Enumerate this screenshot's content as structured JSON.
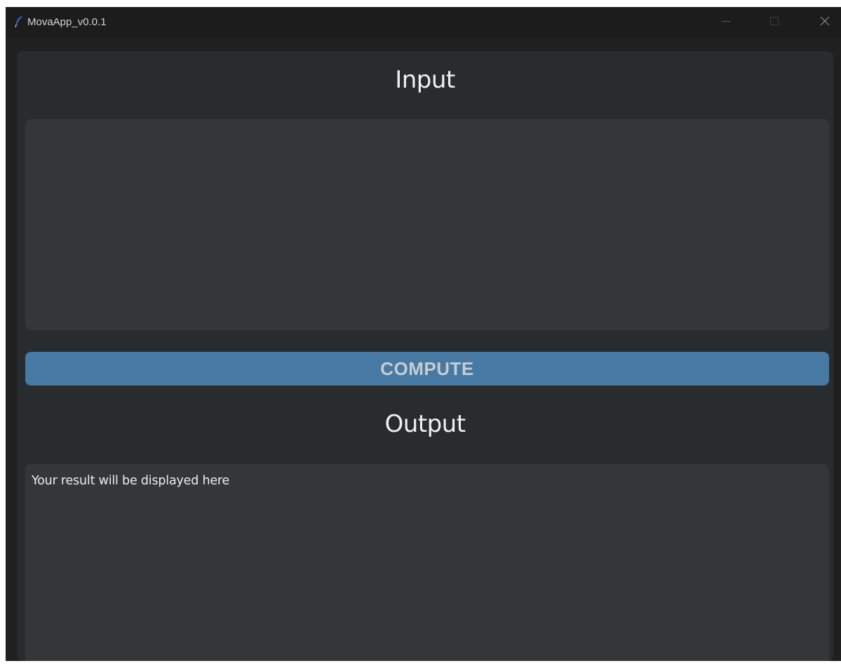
{
  "window": {
    "title": "MovaApp_v0.0.1",
    "icon": "feather-icon"
  },
  "window_controls": {
    "minimize_icon": "minimize-icon",
    "maximize_icon": "maximize-icon",
    "close_icon": "close-icon"
  },
  "input_section": {
    "heading": "Input",
    "value": "",
    "placeholder": ""
  },
  "compute_button": {
    "label": "COMPUTE"
  },
  "output_section": {
    "heading": "Output",
    "text": "Your result will be displayed here"
  },
  "colors": {
    "window_bg": "#202020",
    "panel_bg": "#292c2f",
    "box_bg": "#353638",
    "button_bg": "#4679a4",
    "button_text": "#c7ccd2",
    "text": "#eef0f2"
  }
}
